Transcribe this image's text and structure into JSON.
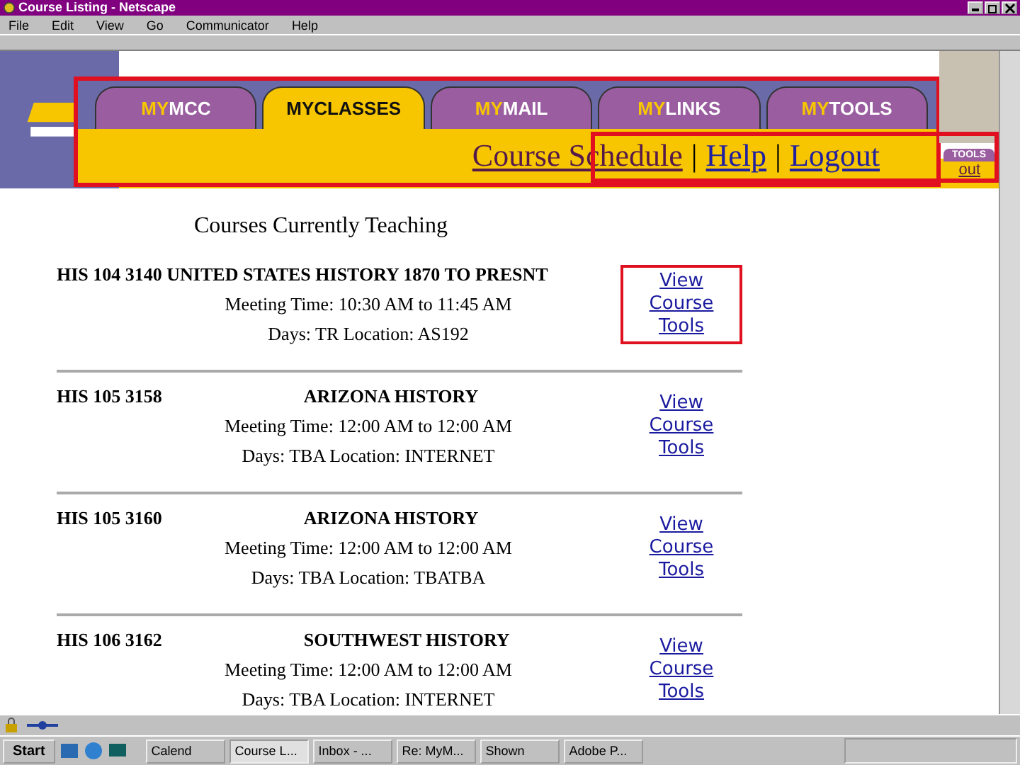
{
  "window": {
    "title": "Course Listing - Netscape"
  },
  "menu": [
    "File",
    "Edit",
    "View",
    "Go",
    "Communicator",
    "Help"
  ],
  "tabs": [
    {
      "prefix": "MY",
      "label": "MCC",
      "selected": false
    },
    {
      "prefix": "MY",
      "label": "CLASSES",
      "selected": true
    },
    {
      "prefix": "MY",
      "label": "MAIL",
      "selected": false
    },
    {
      "prefix": "MY",
      "label": "LINKS",
      "selected": false
    },
    {
      "prefix": "MY",
      "label": "TOOLS",
      "selected": false
    }
  ],
  "nav_links": [
    "Course Schedule",
    "Help",
    "Logout"
  ],
  "nav_separator": "|",
  "background_nav": {
    "tab": "TOOLS",
    "link": "out"
  },
  "heading": "Courses Currently Teaching",
  "courses": [
    {
      "kind": "inline",
      "code": "HIS 104 3140",
      "title": "UNITED STATES HISTORY 1870 TO PRESNT",
      "meeting": "Meeting Time: 10:30 AM to 11:45 AM",
      "days": "Days: TR  Location: AS192",
      "link": "View Course Tools",
      "highlighted": true
    },
    {
      "kind": "split",
      "code": "HIS 105 3158",
      "title": "ARIZONA HISTORY",
      "meeting": "Meeting Time: 12:00 AM to 12:00 AM",
      "days": "Days: TBA  Location: INTERNET",
      "link": "View Course Tools",
      "highlighted": false
    },
    {
      "kind": "split",
      "code": "HIS 105 3160",
      "title": "ARIZONA HISTORY",
      "meeting": "Meeting Time: 12:00 AM to 12:00 AM",
      "days": "Days: TBA  Location: TBATBA",
      "link": "View Course Tools",
      "highlighted": false
    },
    {
      "kind": "split",
      "code": "HIS 106 3162",
      "title": "SOUTHWEST HISTORY",
      "meeting": "Meeting Time: 12:00 AM to 12:00 AM",
      "days": "Days: TBA  Location: INTERNET",
      "link": "View Course Tools",
      "highlighted": false
    }
  ],
  "taskbar": {
    "start": "Start",
    "items": [
      {
        "label": "Calend",
        "selected": false
      },
      {
        "label": "Course L...",
        "selected": true
      },
      {
        "label": "Inbox - ...",
        "selected": false
      },
      {
        "label": "Re: MyM...",
        "selected": false
      },
      {
        "label": "Shown",
        "selected": false
      },
      {
        "label": "Adobe P...",
        "selected": false
      }
    ]
  }
}
